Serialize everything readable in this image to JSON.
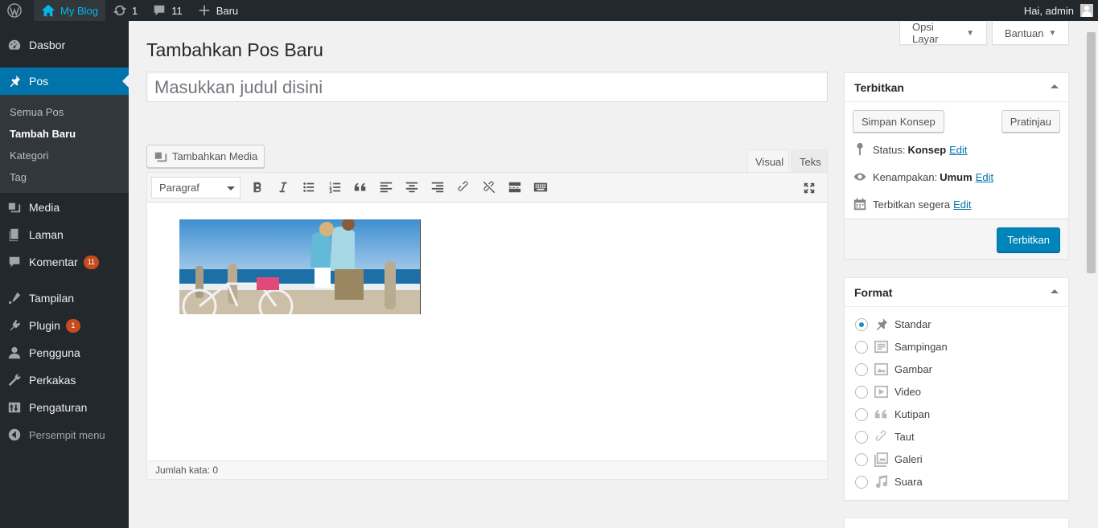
{
  "adminbar": {
    "blog_name": "My Blog",
    "updates_count": "1",
    "comments_count": "11",
    "new_label": "Baru",
    "greeting": "Hai, admin"
  },
  "sidebar": {
    "items": [
      {
        "label": "Dasbor",
        "icon": "dashboard-icon"
      },
      {
        "label": "Pos",
        "icon": "pin-icon"
      },
      {
        "label": "Media",
        "icon": "media-icon"
      },
      {
        "label": "Laman",
        "icon": "page-icon"
      },
      {
        "label": "Komentar",
        "icon": "comment-icon",
        "badge": "11"
      },
      {
        "label": "Tampilan",
        "icon": "appearance-icon"
      },
      {
        "label": "Plugin",
        "icon": "plugin-icon",
        "badge": "1"
      },
      {
        "label": "Pengguna",
        "icon": "users-icon"
      },
      {
        "label": "Perkakas",
        "icon": "tools-icon"
      },
      {
        "label": "Pengaturan",
        "icon": "settings-icon"
      }
    ],
    "submenu": [
      "Semua Pos",
      "Tambah Baru",
      "Kategori",
      "Tag"
    ],
    "collapse": "Persempit menu"
  },
  "header": {
    "screen_options": "Opsi Layar",
    "help": "Bantuan",
    "title": "Tambahkan Pos Baru"
  },
  "editor": {
    "title_placeholder": "Masukkan judul disini",
    "add_media": "Tambahkan Media",
    "tab_visual": "Visual",
    "tab_text": "Teks",
    "format_select": "Paragraf",
    "word_count": "Jumlah kata: 0"
  },
  "publish": {
    "title": "Terbitkan",
    "save_draft": "Simpan Konsep",
    "preview": "Pratinjau",
    "status_label": "Status:",
    "status_value": "Konsep",
    "visibility_label": "Kenampakan:",
    "visibility_value": "Umum",
    "schedule_label": "Terbitkan segera",
    "edit": "Edit",
    "publish_button": "Terbitkan"
  },
  "format_box": {
    "title": "Format",
    "options": [
      "Standar",
      "Sampingan",
      "Gambar",
      "Video",
      "Kutipan",
      "Taut",
      "Galeri",
      "Suara"
    ],
    "selected": "Standar"
  },
  "colors": {
    "accent": "#0073aa",
    "admin_bg": "#23282d",
    "badge": "#ca4a1f"
  }
}
